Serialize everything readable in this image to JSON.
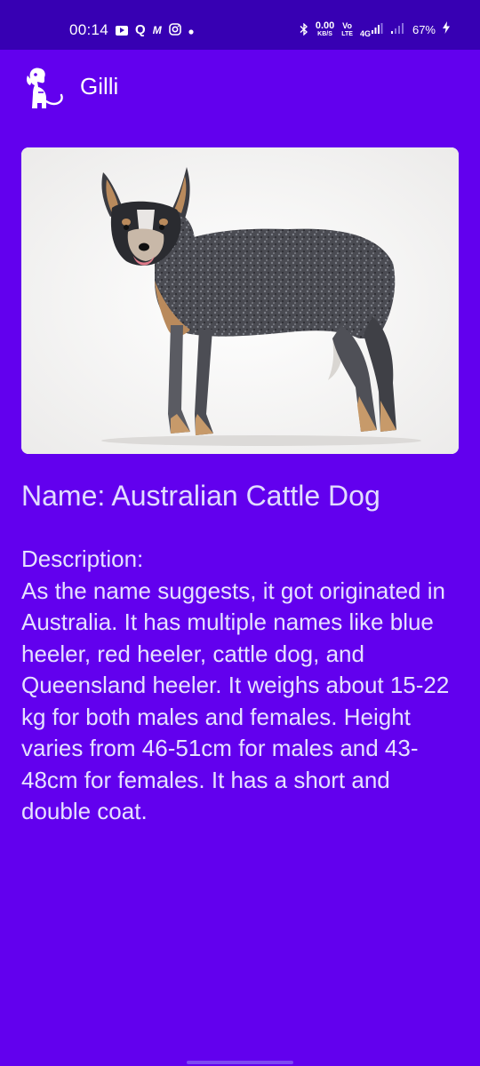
{
  "status_bar": {
    "time": "00:14",
    "data_speed_value": "0.00",
    "data_speed_unit": "KB/S",
    "volte_top": "Vo",
    "volte_bottom": "LTE",
    "network": "4G",
    "battery_percent": "67%",
    "icons": [
      "youtube-icon",
      "q-icon",
      "wallet-icon",
      "instagram-icon",
      "dot-icon",
      "bluetooth-icon",
      "signal-icon",
      "signal-icon-2",
      "charging-icon"
    ]
  },
  "app_bar": {
    "title": "Gilli",
    "logo_icon": "dog-icon"
  },
  "breed": {
    "image_subject": "dog-photo",
    "name_text": "Name: Australian Cattle Dog",
    "description_label": "Description:",
    "description": "As the name suggests, it got originated in Australia. It has multiple names like blue heeler, red heeler, cattle dog, and Queensland heeler. It weighs about 15-22 kg for both males and females. Height varies from 46-51cm for males and 43-48cm for females. It has a short and double coat."
  },
  "colors": {
    "background": "#6200EE",
    "status_bar": "#3700B3",
    "text": "#E6E1FF"
  }
}
